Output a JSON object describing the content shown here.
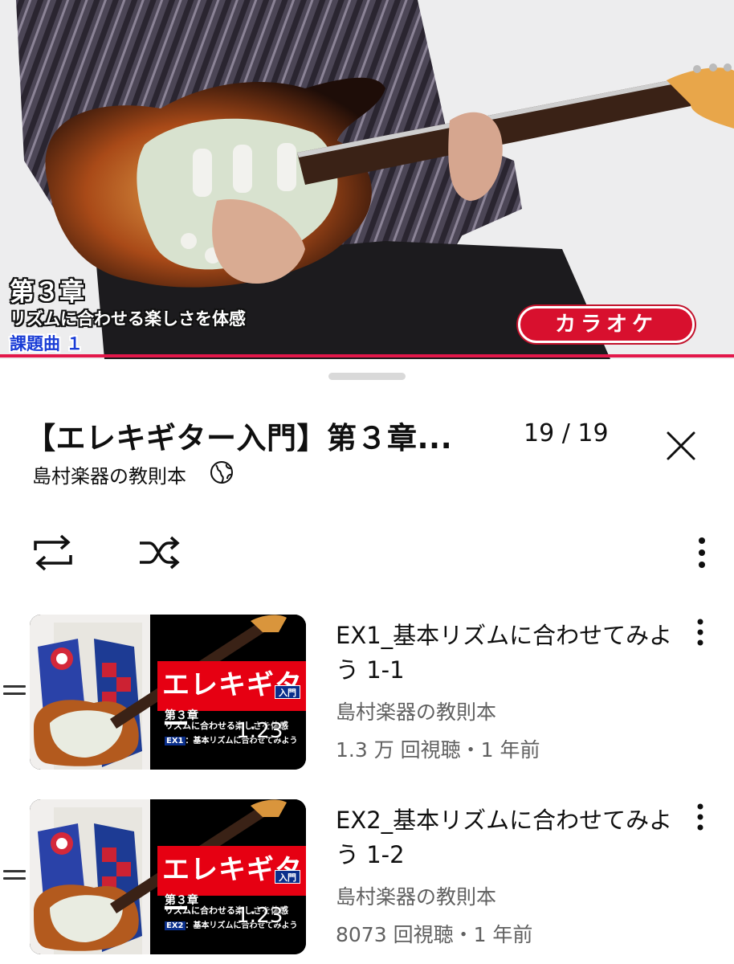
{
  "video": {
    "chapter": "第３章",
    "subtitle": "リズムに合わせる楽しさを体感",
    "task": "課題曲 １",
    "badge": "カラオケ"
  },
  "playlist": {
    "title": "【エレキギター入門】第３章...",
    "position": "19 / 19",
    "channel": "島村楽器の教則本",
    "icons": {
      "close": "close-icon",
      "globe": "globe-icon",
      "loop": "loop-icon",
      "shuffle": "shuffle-icon",
      "menu": "more-vert-icon"
    }
  },
  "items": [
    {
      "title": "EX1_基本リズムに合わせてみよう 1-1",
      "channel": "島村楽器の教則本",
      "meta": "1.3 万 回視聴・1 年前",
      "duration": "1:23",
      "thumb": {
        "brand": "エレキギター",
        "nyumon": "入門",
        "chapter": "第３章",
        "subtitle": "リズムに合わせる楽しさを体感",
        "ex_tag": "EX1",
        "ex_text": "：基本リズムに合わせてみよう"
      }
    },
    {
      "title": "EX2_基本リズムに合わせてみよう 1-2",
      "channel": "島村楽器の教則本",
      "meta": "8073 回視聴・1 年前",
      "duration": "1:23",
      "thumb": {
        "brand": "エレキギター",
        "nyumon": "入門",
        "chapter": "第３章",
        "subtitle": "リズムに合わせる楽しさを体感",
        "ex_tag": "EX2",
        "ex_text": "：基本リズムに合わせてみよう"
      }
    }
  ],
  "colors": {
    "progress": "#e3174a",
    "badge": "#d8102e",
    "secondary_text": "#606060"
  }
}
